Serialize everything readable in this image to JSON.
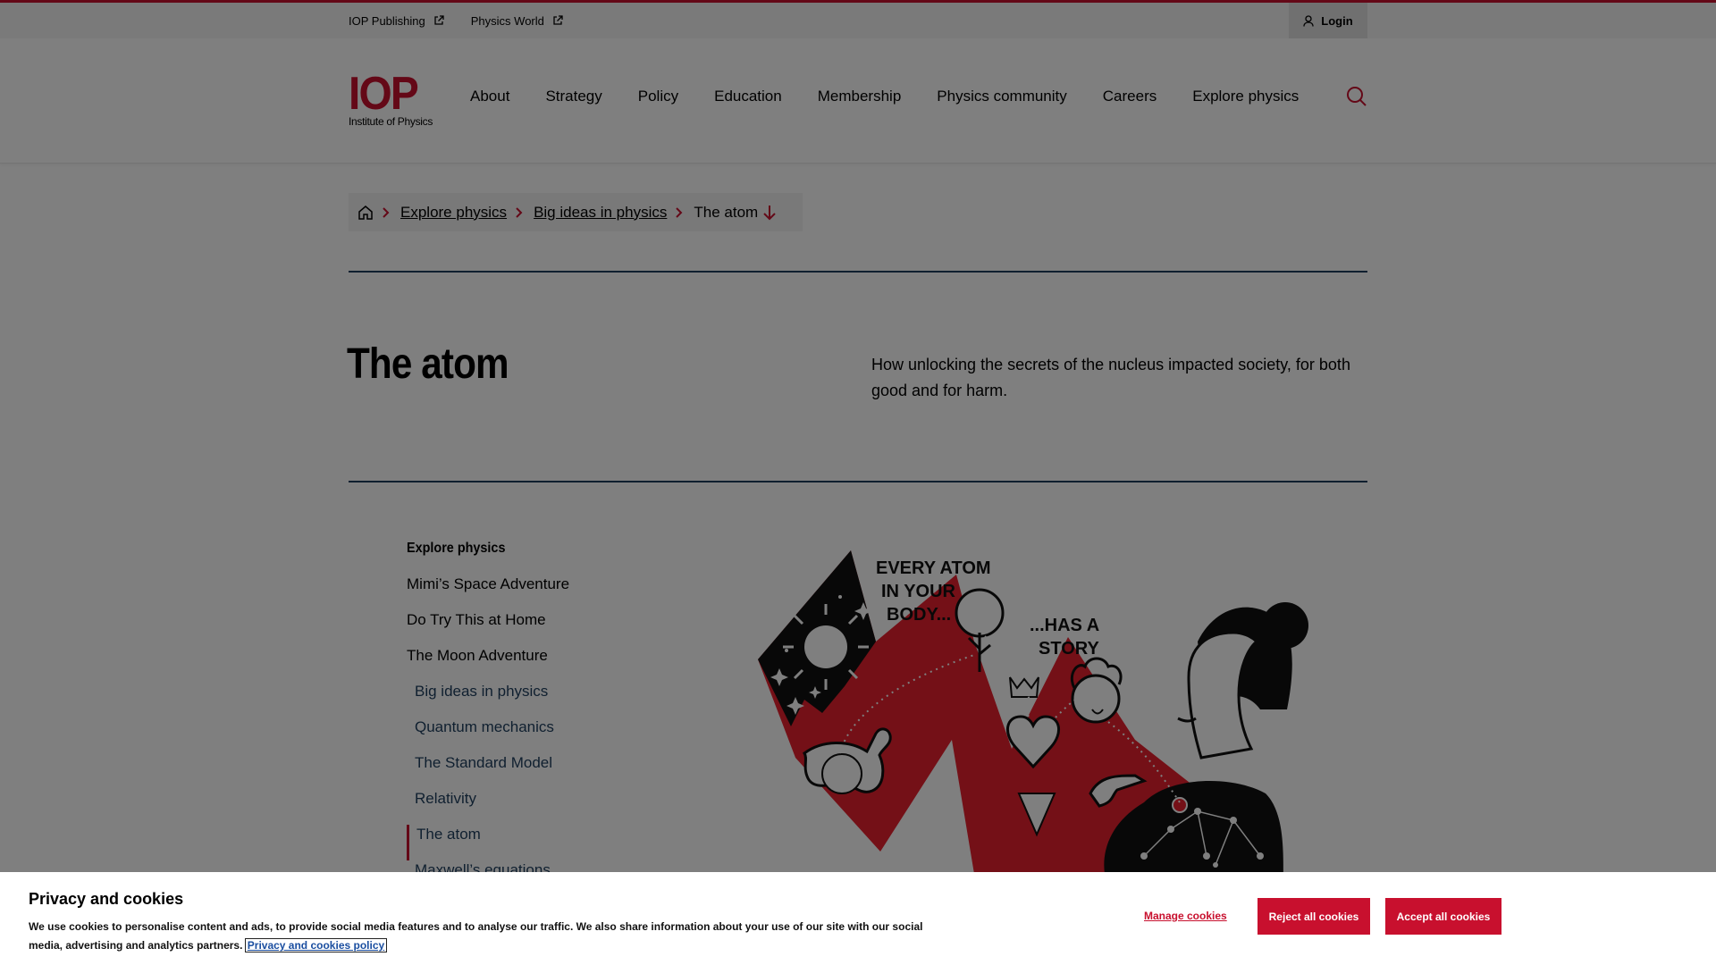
{
  "utility": {
    "links": [
      "IOP Publishing",
      "Physics World"
    ],
    "login": "Login"
  },
  "logo": {
    "mark": "IOP",
    "sub": "Institute of Physics"
  },
  "nav": [
    "About",
    "Strategy",
    "Policy",
    "Education",
    "Membership",
    "Physics community",
    "Careers",
    "Explore physics"
  ],
  "breadcrumb": {
    "items": [
      "Explore physics",
      "Big ideas in physics"
    ],
    "current": "The atom"
  },
  "page": {
    "title": "The atom",
    "intro": "How unlocking the secrets of the nucleus impacted society, for both good and for harm."
  },
  "sidenav": {
    "heading": "Explore physics",
    "items": [
      "Mimi’s Space Adventure",
      "Do Try This at Home",
      "The Moon Adventure"
    ],
    "subitems": [
      "Big ideas in physics",
      "Quantum mechanics",
      "The Standard Model",
      "Relativity"
    ],
    "active": "The atom",
    "next": "Maxwell’s equations"
  },
  "illustration": {
    "caption_1": [
      "EVERY ATOM",
      "IN YOUR",
      "BODY..."
    ],
    "caption_2": [
      "...HAS A",
      "STORY"
    ]
  },
  "cookie": {
    "title": "Privacy and cookies",
    "text": "We use cookies to personalise content and ads, to provide social media features and to analyse our traffic. We also share information about your use of our site with our social media, advertising and analytics partners.",
    "policy_link": "Privacy and cookies policy",
    "manage": "Manage cookies",
    "reject": "Reject all cookies",
    "accept": "Accept all cookies"
  },
  "colors": {
    "brand_red": "#c8102e",
    "navy_rule": "#1f3f5f"
  }
}
